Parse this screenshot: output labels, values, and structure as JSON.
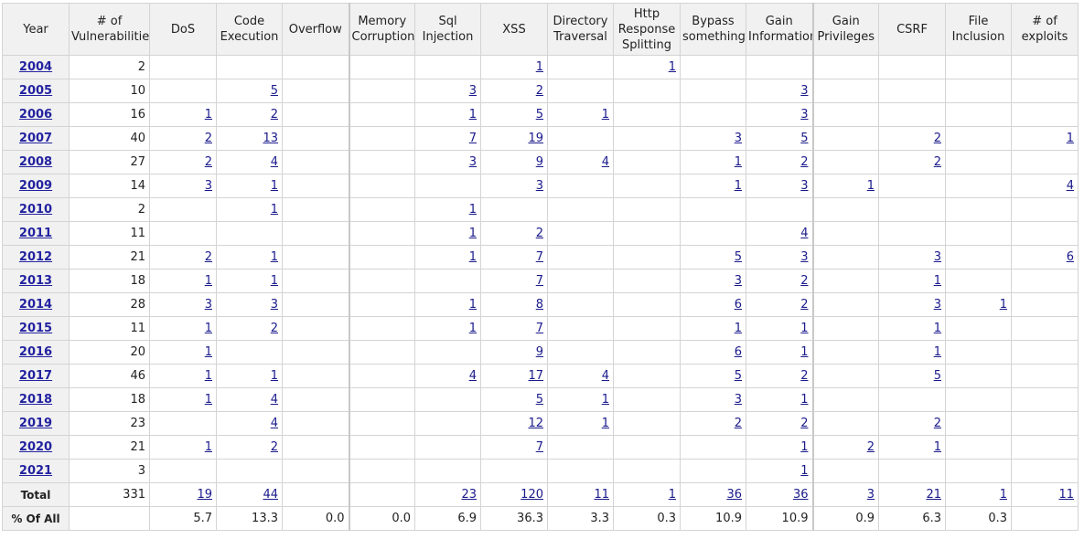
{
  "columns": [
    "Year",
    "# of Vulnerabilities",
    "DoS",
    "Code Execution",
    "Overflow",
    "Memory Corruption",
    "Sql Injection",
    "XSS",
    "Directory Traversal",
    "Http Response Splitting",
    "Bypass something",
    "Gain Information",
    "Gain Privileges",
    "CSRF",
    "File Inclusion",
    "# of exploits"
  ],
  "rows": [
    {
      "year": "2004",
      "cells": [
        "2",
        "",
        "",
        "",
        "",
        "",
        "1",
        "",
        "1",
        "",
        "",
        "",
        "",
        "",
        ""
      ]
    },
    {
      "year": "2005",
      "cells": [
        "10",
        "",
        "5",
        "",
        "",
        "3",
        "2",
        "",
        "",
        "",
        "3",
        "",
        "",
        "",
        ""
      ]
    },
    {
      "year": "2006",
      "cells": [
        "16",
        "1",
        "2",
        "",
        "",
        "1",
        "5",
        "1",
        "",
        "",
        "3",
        "",
        "",
        "",
        ""
      ]
    },
    {
      "year": "2007",
      "cells": [
        "40",
        "2",
        "13",
        "",
        "",
        "7",
        "19",
        "",
        "",
        "3",
        "5",
        "",
        "2",
        "",
        "1"
      ]
    },
    {
      "year": "2008",
      "cells": [
        "27",
        "2",
        "4",
        "",
        "",
        "3",
        "9",
        "4",
        "",
        "1",
        "2",
        "",
        "2",
        "",
        ""
      ]
    },
    {
      "year": "2009",
      "cells": [
        "14",
        "3",
        "1",
        "",
        "",
        "",
        "3",
        "",
        "",
        "1",
        "3",
        "1",
        "",
        "",
        "4"
      ]
    },
    {
      "year": "2010",
      "cells": [
        "2",
        "",
        "1",
        "",
        "",
        "1",
        "",
        "",
        "",
        "",
        "",
        "",
        "",
        "",
        ""
      ]
    },
    {
      "year": "2011",
      "cells": [
        "11",
        "",
        "",
        "",
        "",
        "1",
        "2",
        "",
        "",
        "",
        "4",
        "",
        "",
        "",
        ""
      ]
    },
    {
      "year": "2012",
      "cells": [
        "21",
        "2",
        "1",
        "",
        "",
        "1",
        "7",
        "",
        "",
        "5",
        "3",
        "",
        "3",
        "",
        "6"
      ]
    },
    {
      "year": "2013",
      "cells": [
        "18",
        "1",
        "1",
        "",
        "",
        "",
        "7",
        "",
        "",
        "3",
        "2",
        "",
        "1",
        "",
        ""
      ]
    },
    {
      "year": "2014",
      "cells": [
        "28",
        "3",
        "3",
        "",
        "",
        "1",
        "8",
        "",
        "",
        "6",
        "2",
        "",
        "3",
        "1",
        ""
      ]
    },
    {
      "year": "2015",
      "cells": [
        "11",
        "1",
        "2",
        "",
        "",
        "1",
        "7",
        "",
        "",
        "1",
        "1",
        "",
        "1",
        "",
        ""
      ]
    },
    {
      "year": "2016",
      "cells": [
        "20",
        "1",
        "",
        "",
        "",
        "",
        "9",
        "",
        "",
        "6",
        "1",
        "",
        "1",
        "",
        ""
      ]
    },
    {
      "year": "2017",
      "cells": [
        "46",
        "1",
        "1",
        "",
        "",
        "4",
        "17",
        "4",
        "",
        "5",
        "2",
        "",
        "5",
        "",
        ""
      ]
    },
    {
      "year": "2018",
      "cells": [
        "18",
        "1",
        "4",
        "",
        "",
        "",
        "5",
        "1",
        "",
        "3",
        "1",
        "",
        "",
        "",
        ""
      ]
    },
    {
      "year": "2019",
      "cells": [
        "23",
        "",
        "4",
        "",
        "",
        "",
        "12",
        "1",
        "",
        "2",
        "2",
        "",
        "2",
        "",
        ""
      ]
    },
    {
      "year": "2020",
      "cells": [
        "21",
        "1",
        "2",
        "",
        "",
        "",
        "7",
        "",
        "",
        "",
        "1",
        "2",
        "1",
        "",
        ""
      ]
    },
    {
      "year": "2021",
      "cells": [
        "3",
        "",
        "",
        "",
        "",
        "",
        "",
        "",
        "",
        "",
        "1",
        "",
        "",
        "",
        ""
      ]
    }
  ],
  "total_row": {
    "label": "Total",
    "cells": [
      "331",
      "19",
      "44",
      "",
      "",
      "23",
      "120",
      "11",
      "1",
      "36",
      "36",
      "3",
      "21",
      "1",
      "11"
    ]
  },
  "percent_row": {
    "label": "% Of All",
    "cells": [
      "",
      "5.7",
      "13.3",
      "0.0",
      "0.0",
      "6.9",
      "36.3",
      "3.3",
      "0.3",
      "10.9",
      "10.9",
      "0.9",
      "6.3",
      "0.3",
      ""
    ]
  }
}
